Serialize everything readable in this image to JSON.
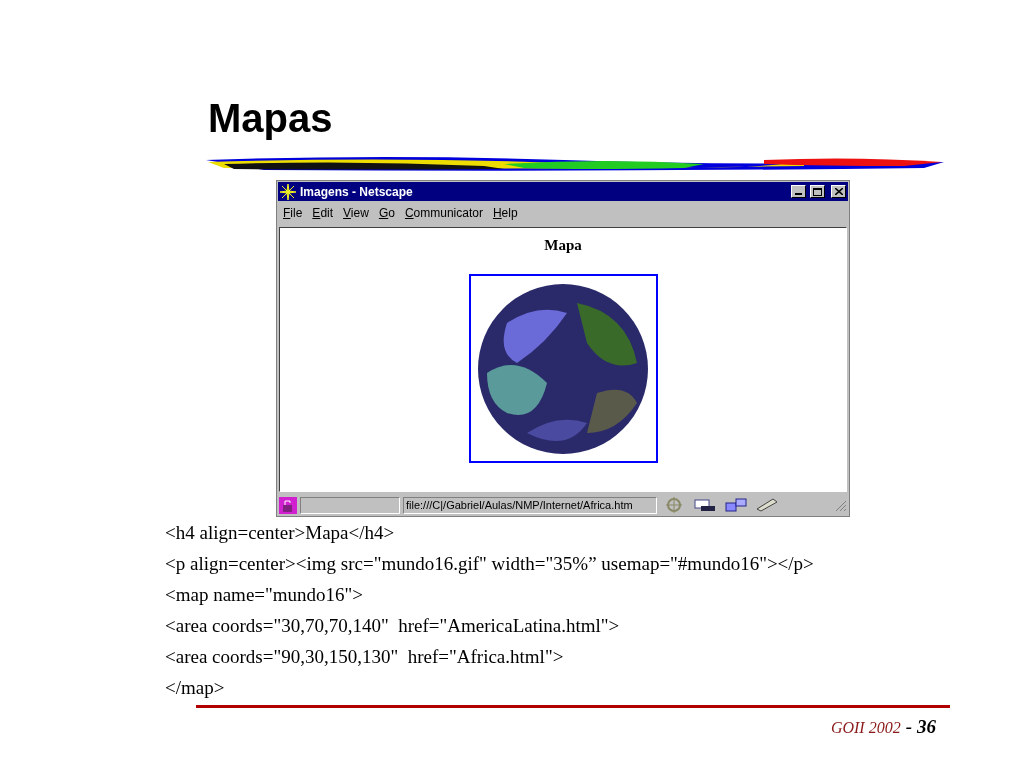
{
  "slide": {
    "title": "Mapas"
  },
  "browser": {
    "title": "Imagens - Netscape",
    "menu": [
      "File",
      "Edit",
      "View",
      "Go",
      "Communicator",
      "Help"
    ],
    "page_heading": "Mapa",
    "status_url": "file:///C|/Gabriel/Aulas/NMP/Internet/Africa.htm"
  },
  "code_lines": [
    "<h4 align=center>Mapa</h4>",
    "<p align=center><img src=\"mundo16.gif\" width=\"35%” usemap=\"#mundo16\"></p>",
    "<map name=\"mundo16\">",
    "<area coords=\"30,70,70,140\"  href=\"AmericaLatina.html\">",
    "<area coords=\"90,30,150,130\"  href=\"Africa.html\">",
    "</map>"
  ],
  "footer": {
    "course": "GOII 2002",
    "separator": "-",
    "page": "36"
  }
}
